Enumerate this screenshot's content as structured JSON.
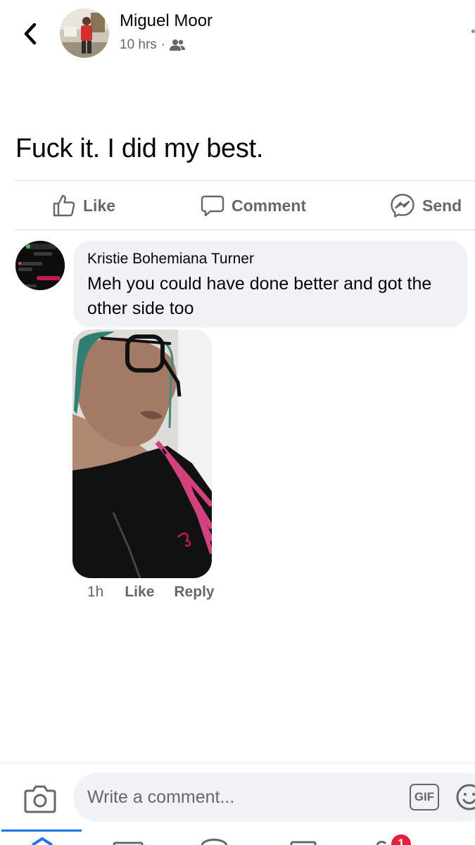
{
  "post": {
    "author": "Miguel Moor",
    "time": "10 hrs",
    "separator": "·",
    "audience_icon": "friends-icon",
    "text": "Fuck it. I did my best."
  },
  "actions": {
    "like_label": "Like",
    "comment_label": "Comment",
    "send_label": "Send"
  },
  "comment": {
    "author": "Kristie Bohemiana Turner",
    "text": "Meh you could have done better and got the other side too",
    "time": "1h",
    "like_label": "Like",
    "reply_label": "Reply"
  },
  "composer": {
    "placeholder": "Write a comment...",
    "gif_label": "GIF"
  },
  "tabbar": {
    "notification_count": "1"
  },
  "colors": {
    "accent": "#1877f2",
    "secondary_text": "#65676b",
    "bubble_bg": "#f0f2f5",
    "badge": "#e41e3f"
  }
}
